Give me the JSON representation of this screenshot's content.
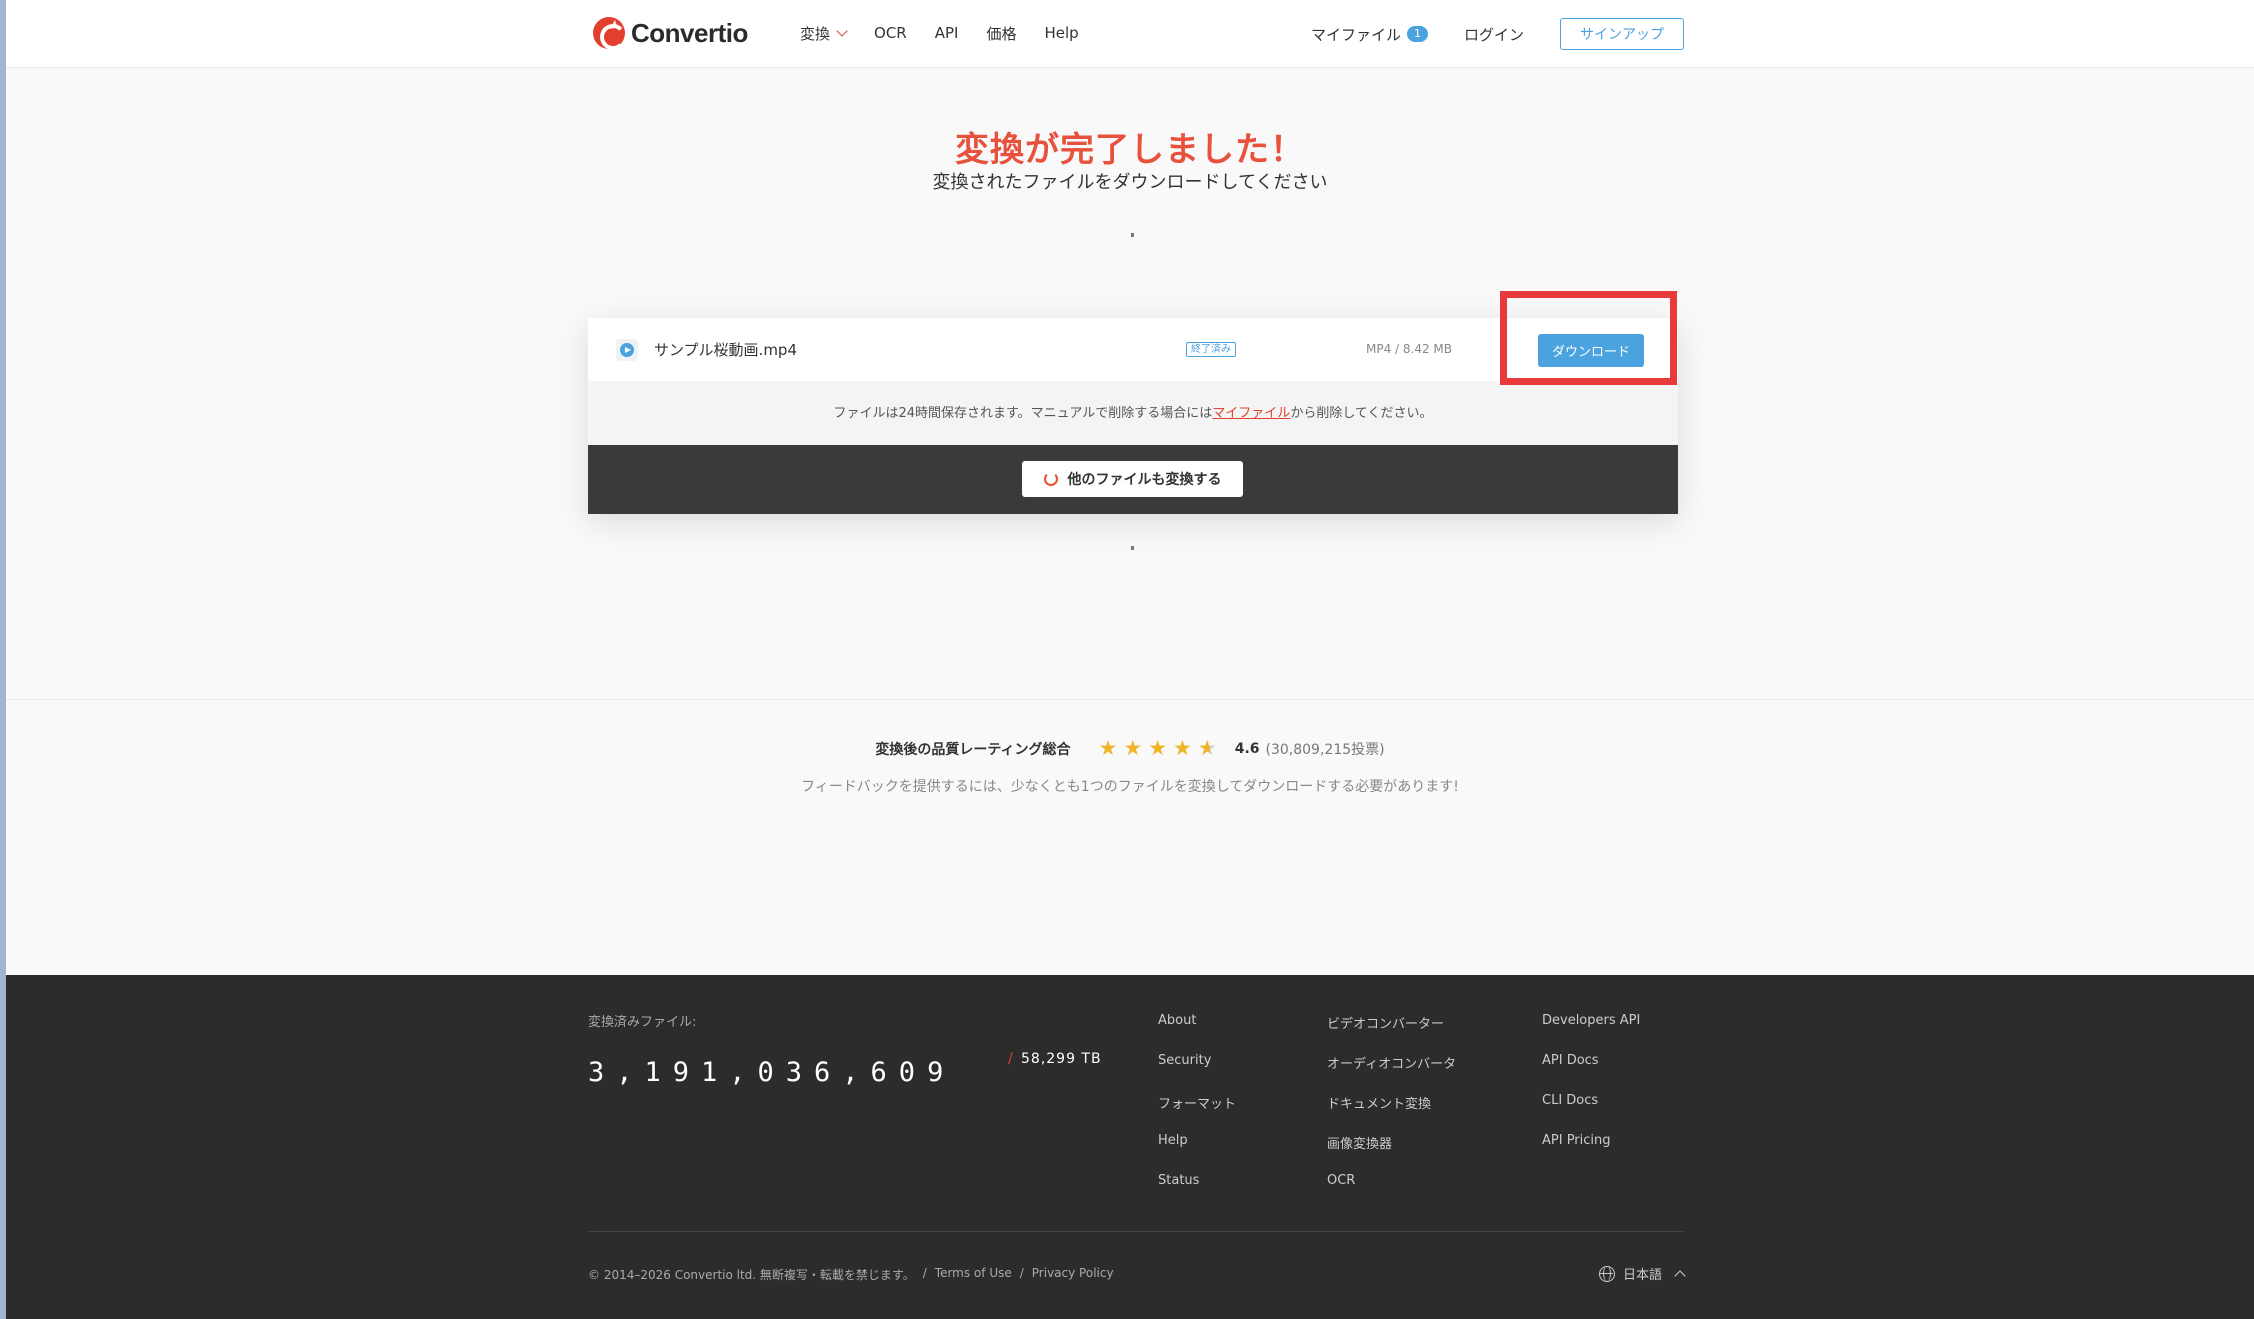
{
  "header": {
    "logo_text": "Convertio",
    "nav": [
      {
        "label": "変換",
        "has_dropdown": true
      },
      {
        "label": "OCR"
      },
      {
        "label": "API"
      },
      {
        "label": "価格"
      },
      {
        "label": "Help"
      }
    ],
    "my_files_label": "マイファイル",
    "my_files_count": "1",
    "login_label": "ログイン",
    "signup_label": "サインアップ"
  },
  "main": {
    "title": "変換が完了しました！",
    "subtitle": "変換されたファイルをダウンロードしてください"
  },
  "file": {
    "name": "サンプル桜動画.mp4",
    "status": "終了済み",
    "meta": "MP4 / 8.42 MB",
    "download_label": "ダウンロード",
    "notice_before": "ファイルは24時間保存されます。マニュアルで削除する場合には",
    "notice_link": "マイファイル",
    "notice_after": "から削除してください。",
    "convert_more_label": "他のファイルも変換する"
  },
  "rating": {
    "label": "変換後の品質レーティング総合",
    "score": "4.6",
    "score_value": 4.6,
    "votes": "(30,809,215投票)",
    "feedback": "フィードバックを提供するには、少なくとも1つのファイルを変換してダウンロードする必要があります!"
  },
  "footer": {
    "converted_label": "変換済みファイル:",
    "counter": "3,191,036,609",
    "slash": "/",
    "tb": "58,299 TB",
    "col1": [
      "About",
      "Security",
      "フォーマット",
      "Help",
      "Status"
    ],
    "col2": [
      "ビデオコンバーター",
      "オーディオコンバータ",
      "ドキュメント変換",
      "画像変換器",
      "OCR"
    ],
    "col3": [
      "Developers API",
      "API Docs",
      "CLI Docs",
      "API Pricing"
    ],
    "copyright": "© 2014–2026 Convertio ltd. 無断複写・転載を禁じます。",
    "sep": "/",
    "terms": "Terms of Use",
    "privacy": "Privacy Policy",
    "language": "日本語"
  },
  "colors": {
    "accent_red": "#e33f2f",
    "title_red": "#e8513c",
    "blue": "#4aa3df",
    "highlight_red": "#e83a3a",
    "footer_bg": "#2c2c2c",
    "star": "#f0b429"
  }
}
